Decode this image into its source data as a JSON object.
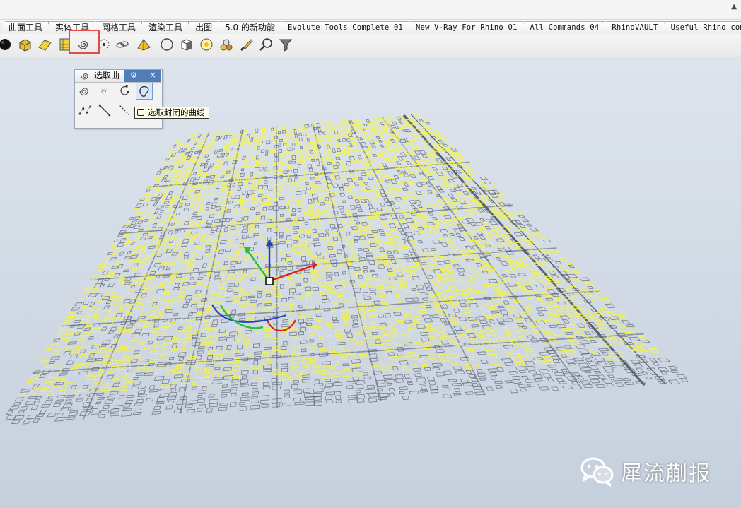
{
  "toolbar_tabs": [
    {
      "label": "曲面工具",
      "mono": false
    },
    {
      "label": "实体工具",
      "mono": false
    },
    {
      "label": "网格工具",
      "mono": false
    },
    {
      "label": "渲染工具",
      "mono": false
    },
    {
      "label": "出图",
      "mono": false
    },
    {
      "label": "5.0 的新功能",
      "mono": false
    },
    {
      "label": "Evolute Tools Complete 01",
      "mono": true
    },
    {
      "label": "New V-Ray For Rhino 01",
      "mono": true
    },
    {
      "label": "All Commands 04",
      "mono": true
    },
    {
      "label": "RhinoVAULT",
      "mono": true
    },
    {
      "label": "Useful Rhino command",
      "mono": true
    }
  ],
  "toolbar_icons": [
    "sphere-icon",
    "box-icon",
    "plane-icon",
    "grid-surface-icon",
    "select-curves-icon",
    "select-points-icon",
    "chain-link-icon",
    "prism-icon",
    "circle-icon",
    "cube-icon",
    "light-icon",
    "materials-icon",
    "brush-icon",
    "zoom-icon",
    "filter-icon"
  ],
  "selected_toolbar_icon": "select-curves-icon",
  "panel": {
    "title": "选取曲",
    "buttons": [
      "select-curves-icon",
      "select-dashed-curves-icon",
      "select-open-curves-icon",
      "select-closed-curves-icon",
      "select-polyline-points-icon",
      "select-line-icon",
      "select-dashed-line-icon"
    ],
    "active_button": "select-closed-curves-icon"
  },
  "tooltip": {
    "text": "选取封闭的曲线"
  },
  "gizmo": {
    "x_axis_color": "#e02020",
    "y_axis_color": "#20c040",
    "z_axis_color": "#2040d0"
  },
  "colors": {
    "selected_curves": "#f5f542",
    "unselected_curves": "#505a66",
    "highlight_box": "#e34a4a"
  },
  "watermark": {
    "text": "犀流蒯报"
  }
}
